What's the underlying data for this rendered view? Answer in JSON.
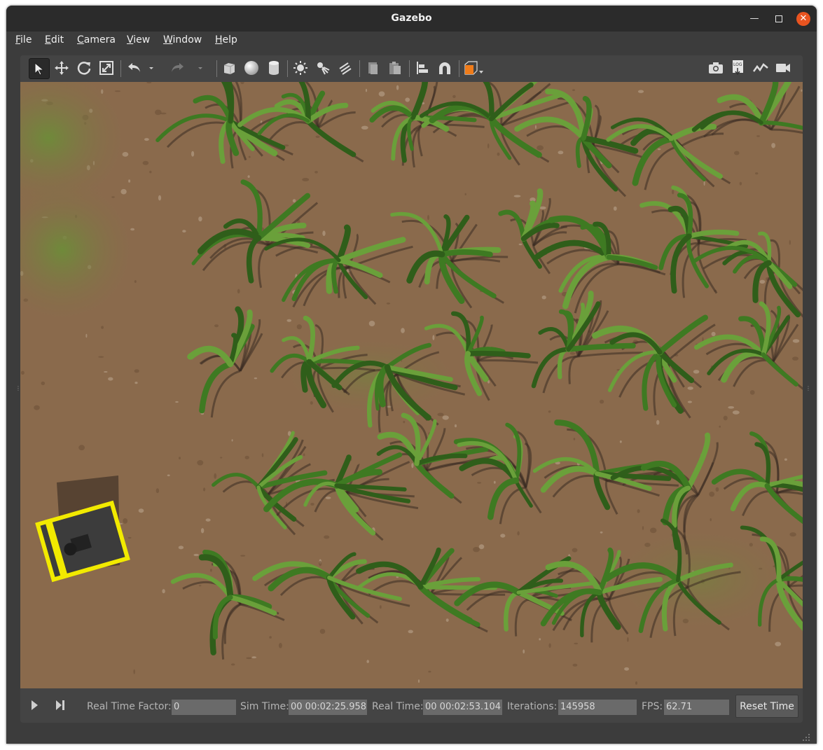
{
  "window": {
    "title": "Gazebo"
  },
  "menu": [
    {
      "label": "File",
      "accel": "F",
      "rest": "ile"
    },
    {
      "label": "Edit",
      "accel": "E",
      "rest": "dit"
    },
    {
      "label": "Camera",
      "accel": "C",
      "rest": "amera"
    },
    {
      "label": "View",
      "accel": "V",
      "rest": "iew"
    },
    {
      "label": "Window",
      "accel": "W",
      "rest": "indow"
    },
    {
      "label": "Help",
      "accel": "H",
      "rest": "elp"
    }
  ],
  "toolbar": {
    "tools": [
      "select-mode",
      "translate-mode",
      "rotate-mode",
      "scale-mode",
      "undo",
      "undo-history",
      "redo",
      "redo-history",
      "box",
      "sphere",
      "cylinder",
      "point-light",
      "spot-light",
      "directional-light",
      "copy",
      "paste",
      "align",
      "snap",
      "change-view-angle"
    ],
    "right_tools": [
      "screenshot",
      "log",
      "plot",
      "record-video"
    ],
    "log_text": "LOG"
  },
  "status": {
    "real_time_factor_label": "Real Time Factor:",
    "real_time_factor": "0",
    "sim_time_label": "Sim Time:",
    "sim_time": "00 00:02:25.958",
    "real_time_label": "Real Time:",
    "real_time": "00 00:02:53.104",
    "iterations_label": "Iterations:",
    "iterations": "145958",
    "fps_label": "FPS:",
    "fps": "62.71",
    "reset_label": "Reset Time"
  },
  "colors": {
    "titlebar": "#2b2b2b",
    "close_button": "#e95420",
    "soil": "#8a6a4c",
    "leaf": "#3e7a22",
    "robot_yellow": "#f2ea00",
    "robot_body": "#3c3c3c"
  }
}
